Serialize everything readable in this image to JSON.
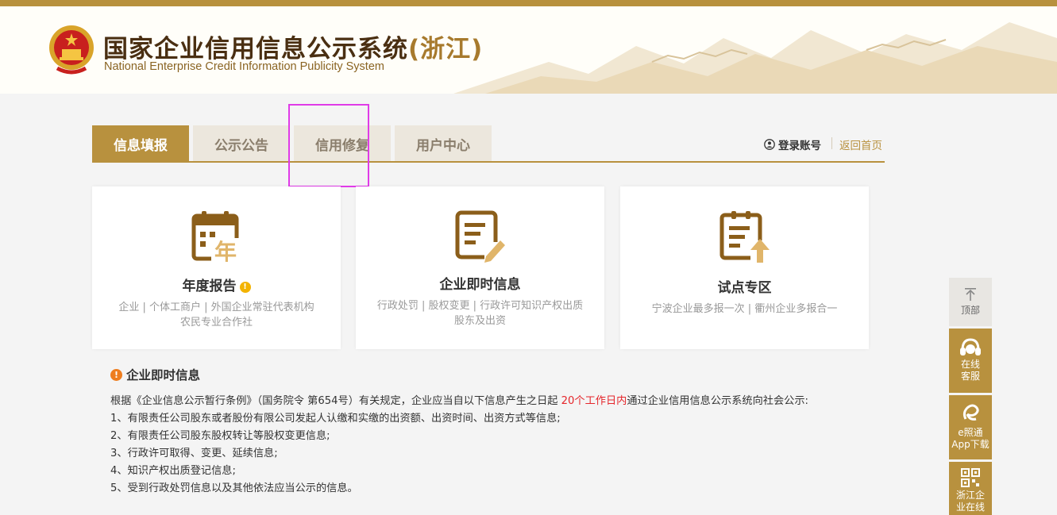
{
  "header": {
    "title_cn": "国家企业信用信息公示系统",
    "title_region": "(浙江)",
    "title_en": "National Enterprise Credit Information Publicity System"
  },
  "tabs": [
    {
      "label": "信息填报",
      "active": true
    },
    {
      "label": "公示公告",
      "active": false
    },
    {
      "label": "信用修复",
      "active": false
    },
    {
      "label": "用户中心",
      "active": false
    }
  ],
  "account": {
    "login_label": "登录账号",
    "home_label": "返回首页"
  },
  "cards": [
    {
      "title": "年度报告",
      "icon": "annual-report-icon",
      "desc_lines": [
        "企业 | 个体工商户 | 外国企业常驻代表机构",
        "农民专业合作社"
      ]
    },
    {
      "title": "企业即时信息",
      "icon": "edit-document-icon",
      "desc_lines": [
        "行政处罚 | 股权变更 | 行政许可知识产权出质",
        "股东及出资"
      ]
    },
    {
      "title": "试点专区",
      "icon": "upload-clipboard-icon",
      "desc_lines": [
        "宁波企业最多报一次 | 衢州企业多报合一"
      ]
    }
  ],
  "info": {
    "heading": "企业即时信息",
    "intro_before": "根据《企业信息公示暂行条例》（国务院令 第654号）有关规定，企业应当自以下信息产生之日起 ",
    "intro_highlight": "20个工作日内",
    "intro_after": "通过企业信用信息公示系统向社会公示:",
    "items": [
      "1、有限责任公司股东或者股份有限公司发起人认缴和实缴的出资额、出资时间、出资方式等信息;",
      "2、有限责任公司股东股权转让等股权变更信息;",
      "3、行政许可取得、变更、延续信息;",
      "4、知识产权出质登记信息;",
      "5、受到行政处罚信息以及其他依法应当公示的信息。"
    ]
  },
  "sidebar": {
    "top_label": "顶部",
    "service_label_1": "在线",
    "service_label_2": "客服",
    "app_label_1": "e照通",
    "app_label_2": "App下载",
    "zj_label_1": "浙江企",
    "zj_label_2": "业在线"
  },
  "colors": {
    "gold": "#b8913e",
    "highlight_box": "#e03be8",
    "warning_red": "#e5262b"
  }
}
